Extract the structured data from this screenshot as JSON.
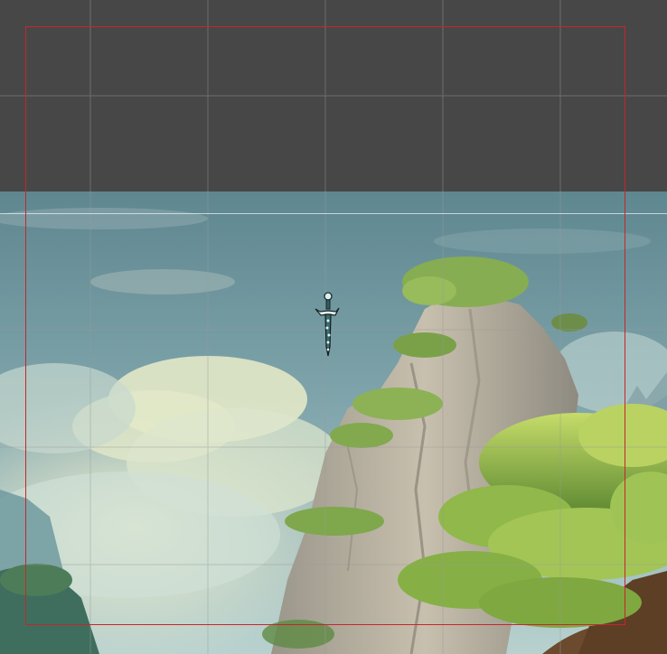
{
  "editor": {
    "view": "scene-view",
    "background_color": "#474747",
    "camera_bounds_color": "#c5262c",
    "grid_color": "#8a8a8a"
  },
  "scene": {
    "background_image": "fantasy-mountain-landscape",
    "elements": [
      "sky",
      "clouds",
      "rock-pillar",
      "trees"
    ]
  },
  "sprite": {
    "name": "dagger",
    "icon": "sword-icon"
  }
}
